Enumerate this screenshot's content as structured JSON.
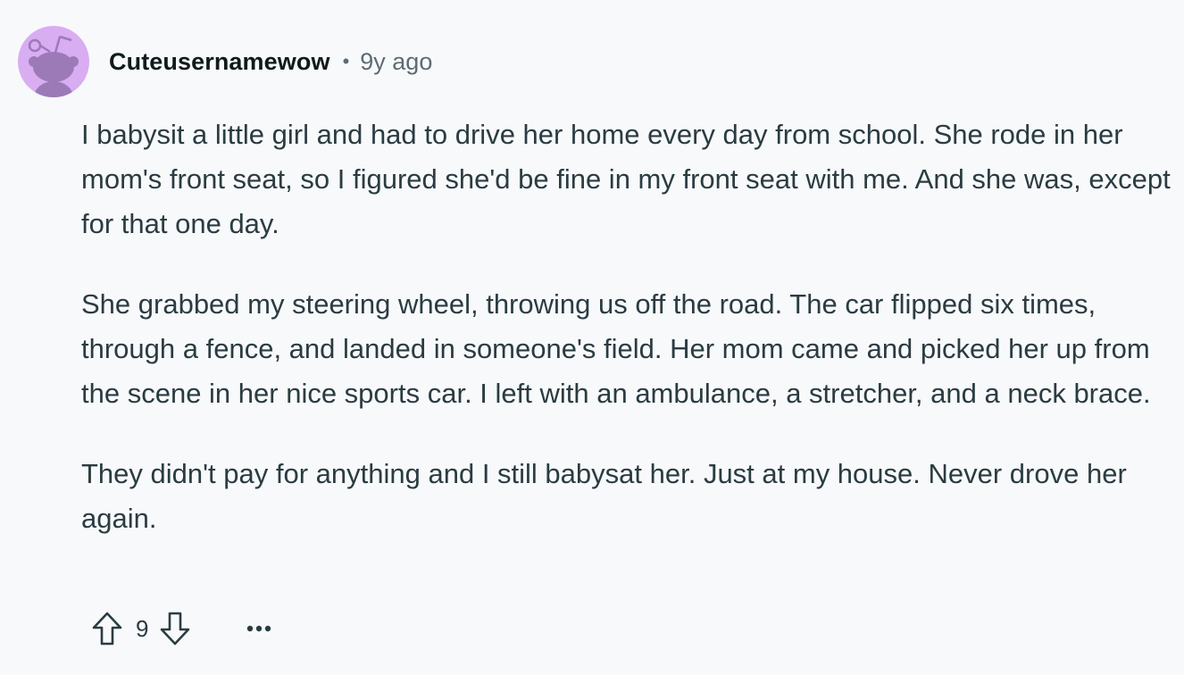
{
  "comment": {
    "author": "Cuteusernamewow",
    "separator": "•",
    "timestamp": "9y ago",
    "paragraphs": [
      "I babysit a little girl and had to drive her home every day from school. She rode in her mom's front seat, so I figured she'd be fine in my front seat with me. And she was, except for that one day.",
      "She grabbed my steering wheel, throwing us off the road. The car flipped six times, through a fence, and landed in someone's field. Her mom came and picked her up from the scene in her nice sports car. I left with an ambulance, a stretcher, and a neck brace.",
      "They didn't pay for anything and I still babysat her. Just at my house. Never drove her again."
    ],
    "actions": {
      "upvote_icon": "upvote-arrow-icon",
      "vote_count": "9",
      "downvote_icon": "downvote-arrow-icon",
      "more_icon": "ellipsis-icon"
    }
  },
  "colors": {
    "background": "#f8f9fb",
    "avatar_bg": "#d9adf2",
    "avatar_snoo": "#9c7ab8",
    "username": "#0f1a1c",
    "meta": "#5c6c74",
    "body_text": "#2a3c42"
  }
}
